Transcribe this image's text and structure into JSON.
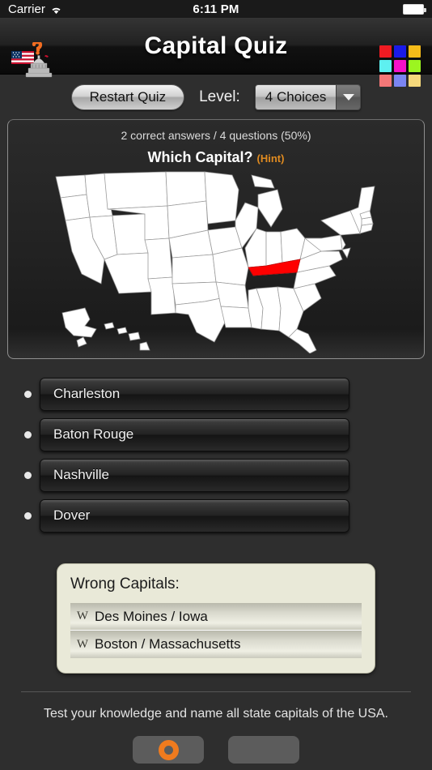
{
  "status_bar": {
    "carrier": "Carrier",
    "wifi_icon": "wifi-icon",
    "time": "6:11 PM",
    "battery_icon": "battery-full-icon"
  },
  "header": {
    "title": "Capital Quiz",
    "logo_icon": "us-flag-capitol-question-logo",
    "color_grid_icon": "color-grid-icon",
    "color_grid": [
      "#ef1b22",
      "#1a1ae8",
      "#f5bb19",
      "#5ef0f0",
      "#f510c8",
      "#9cf520",
      "#f47777",
      "#7b85f2",
      "#f5d87b"
    ]
  },
  "toolbar": {
    "restart_label": "Restart Quiz",
    "level_label": "Level:",
    "level_value": "4 Choices",
    "level_options": [
      "4 Choices"
    ],
    "dropdown_icon": "chevron-down-icon"
  },
  "quiz": {
    "score_text": "2 correct answers / 4 questions (50%)",
    "correct_count": 2,
    "question_count": 4,
    "percent": "50%",
    "question_label": "Which Capital?",
    "hint_label": "(Hint)",
    "hint_color": "#e08b20",
    "map_icon": "usa-map",
    "highlighted_state": "Tennessee",
    "highlight_color": "#fe0000"
  },
  "answers": [
    {
      "label": "Charleston"
    },
    {
      "label": "Baton Rouge"
    },
    {
      "label": "Nashville"
    },
    {
      "label": "Dover"
    }
  ],
  "wrong_capitals": {
    "title": "Wrong Capitals:",
    "items": [
      {
        "marker": "W",
        "label": "Des Moines / Iowa"
      },
      {
        "marker": "W",
        "label": "Boston / Massachusetts"
      }
    ]
  },
  "footer": {
    "description": "Test your knowledge and name all state capitals of the USA.",
    "buttons": [
      {
        "icon": "record-ring-icon",
        "label": ""
      },
      {
        "icon": "blank-icon",
        "label": ""
      }
    ]
  }
}
